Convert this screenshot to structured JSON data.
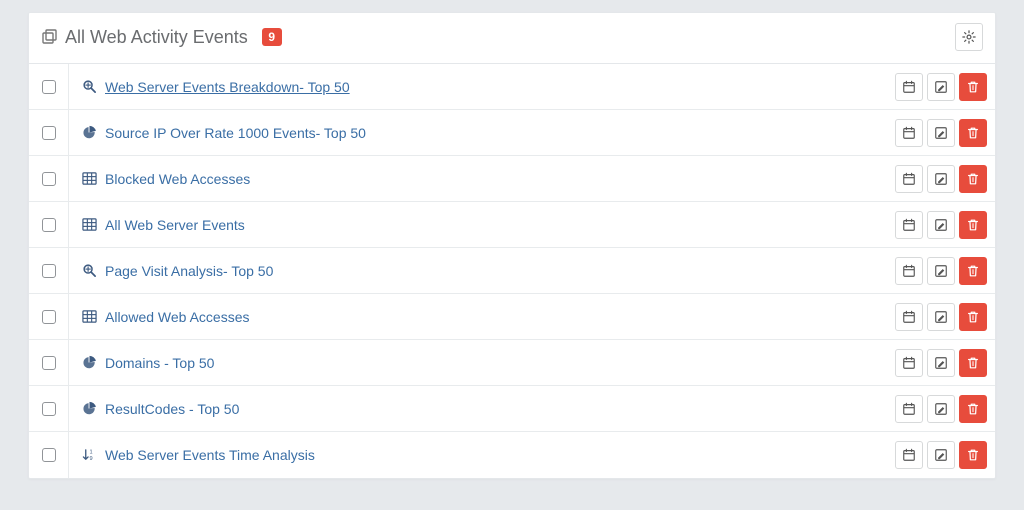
{
  "header": {
    "title": "All Web Activity Events",
    "badge": "9"
  },
  "rows": [
    {
      "icon": "search",
      "label": "Web Server Events Breakdown- Top 50",
      "underlined": true
    },
    {
      "icon": "pie",
      "label": "Source IP Over Rate 1000 Events- Top 50",
      "underlined": false
    },
    {
      "icon": "table",
      "label": "Blocked Web Accesses",
      "underlined": false
    },
    {
      "icon": "table",
      "label": "All Web Server Events",
      "underlined": false
    },
    {
      "icon": "search",
      "label": "Page Visit Analysis- Top 50",
      "underlined": false
    },
    {
      "icon": "table",
      "label": "Allowed Web Accesses",
      "underlined": false
    },
    {
      "icon": "pie",
      "label": "Domains - Top 50",
      "underlined": false
    },
    {
      "icon": "pie",
      "label": "ResultCodes - Top 50",
      "underlined": false
    },
    {
      "icon": "sort",
      "label": "Web Server Events Time Analysis",
      "underlined": false
    }
  ]
}
